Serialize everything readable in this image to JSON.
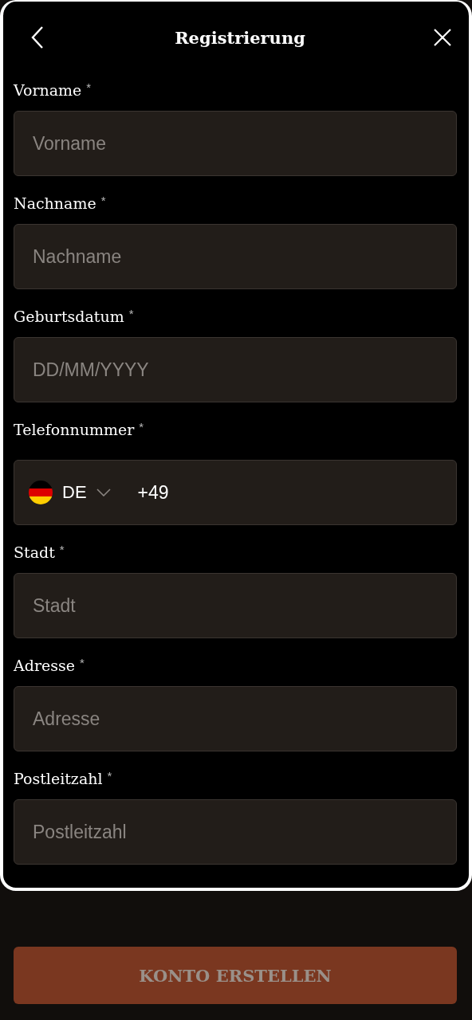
{
  "header": {
    "title": "Registrierung"
  },
  "fields": [
    {
      "kind": "text",
      "label": "Vorname",
      "required_mark": "*",
      "placeholder": "Vorname"
    },
    {
      "kind": "text",
      "label": "Nachname",
      "required_mark": "*",
      "placeholder": "Nachname"
    },
    {
      "kind": "text",
      "label": "Geburtsdatum",
      "required_mark": "*",
      "placeholder": "DD/MM/YYYY"
    },
    {
      "kind": "phone",
      "label": "Telefonnummer",
      "required_mark": "*",
      "country": "DE",
      "value": "+49"
    },
    {
      "kind": "text",
      "label": "Stadt",
      "required_mark": "*",
      "placeholder": "Stadt"
    },
    {
      "kind": "text",
      "label": "Adresse",
      "required_mark": "*",
      "placeholder": "Adresse"
    },
    {
      "kind": "text",
      "label": "Postleitzahl",
      "required_mark": "*",
      "placeholder": "Postleitzahl"
    }
  ],
  "submit_button": {
    "label": "KONTO ERSTELLEN",
    "disabled": true
  }
}
